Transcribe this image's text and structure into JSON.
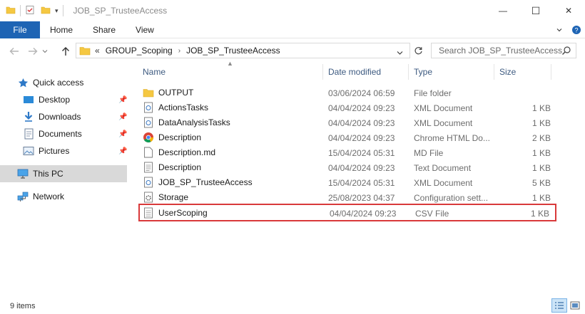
{
  "window": {
    "title": "JOB_SP_TrusteeAccess",
    "minimize_label": "—",
    "maximize_label": "☐",
    "close_label": "✕"
  },
  "ribbon": {
    "tabs": [
      "File",
      "Home",
      "Share",
      "View"
    ]
  },
  "address": {
    "overflow": "«",
    "crumbs": [
      "GROUP_Scoping",
      "JOB_SP_TrusteeAccess"
    ]
  },
  "search": {
    "placeholder": "Search JOB_SP_TrusteeAccess"
  },
  "sidebar": {
    "quick_access": "Quick access",
    "items": [
      {
        "label": "Desktop",
        "icon": "desktop-icon"
      },
      {
        "label": "Downloads",
        "icon": "downloads-icon"
      },
      {
        "label": "Documents",
        "icon": "documents-icon"
      },
      {
        "label": "Pictures",
        "icon": "pictures-icon"
      }
    ],
    "this_pc": "This PC",
    "network": "Network"
  },
  "columns": {
    "name": "Name",
    "date": "Date modified",
    "type": "Type",
    "size": "Size"
  },
  "files": [
    {
      "name": "OUTPUT",
      "date": "03/06/2024 06:59",
      "type": "File folder",
      "size": "",
      "icon": "folder-icon"
    },
    {
      "name": "ActionsTasks",
      "date": "04/04/2024 09:23",
      "type": "XML Document",
      "size": "1 KB",
      "icon": "xml-file-icon"
    },
    {
      "name": "DataAnalysisTasks",
      "date": "04/04/2024 09:23",
      "type": "XML Document",
      "size": "1 KB",
      "icon": "xml-file-icon"
    },
    {
      "name": "Description",
      "date": "04/04/2024 09:23",
      "type": "Chrome HTML Do...",
      "size": "2 KB",
      "icon": "chrome-icon"
    },
    {
      "name": "Description.md",
      "date": "15/04/2024 05:31",
      "type": "MD File",
      "size": "1 KB",
      "icon": "blank-file-icon"
    },
    {
      "name": "Description",
      "date": "04/04/2024 09:23",
      "type": "Text Document",
      "size": "1 KB",
      "icon": "text-file-icon"
    },
    {
      "name": "JOB_SP_TrusteeAccess",
      "date": "15/04/2024 05:31",
      "type": "XML Document",
      "size": "5 KB",
      "icon": "xml-file-icon"
    },
    {
      "name": "Storage",
      "date": "25/08/2023 04:37",
      "type": "Configuration sett...",
      "size": "1 KB",
      "icon": "config-file-icon"
    },
    {
      "name": "UserScoping",
      "date": "04/04/2024 09:23",
      "type": "CSV File",
      "size": "1 KB",
      "icon": "csv-file-icon"
    }
  ],
  "status": {
    "item_count": "9 items"
  }
}
